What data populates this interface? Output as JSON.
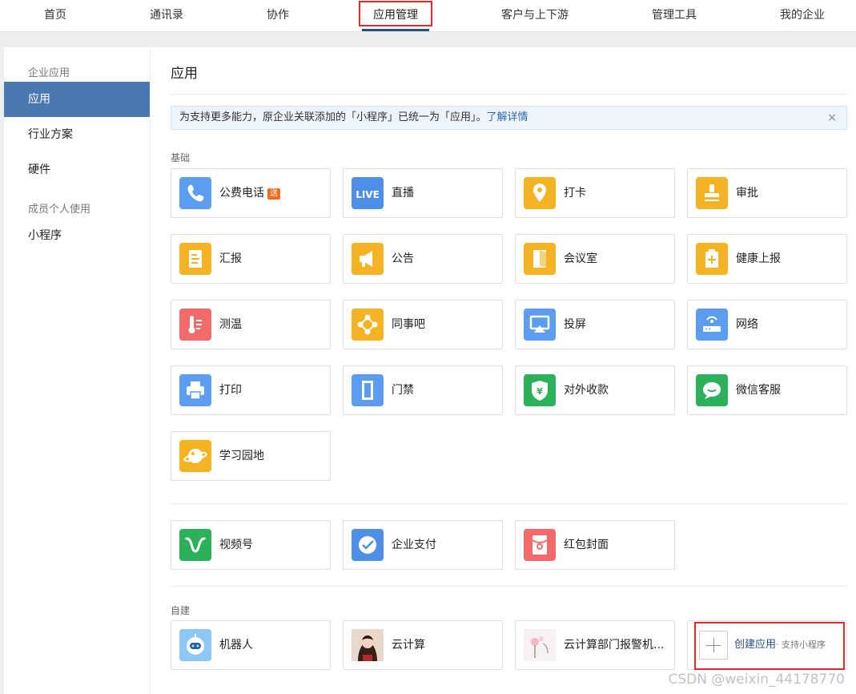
{
  "nav": {
    "tabs": [
      {
        "label": "首页"
      },
      {
        "label": "通讯录"
      },
      {
        "label": "协作"
      },
      {
        "label": "应用管理",
        "active": true
      },
      {
        "label": "客户与上下游"
      },
      {
        "label": "管理工具"
      },
      {
        "label": "我的企业"
      }
    ]
  },
  "sidebar": {
    "group1": "企业应用",
    "items1": [
      "应用",
      "行业方案",
      "硬件"
    ],
    "group2": "成员个人使用",
    "items2": [
      "小程序"
    ]
  },
  "main": {
    "title": "应用",
    "notice": {
      "text": "为支持更多能力，原企业关联添加的「小程序」已统一为「应用」。",
      "link": "了解详情",
      "close": "×"
    },
    "sections": {
      "basic": "基础",
      "custom": "自建"
    },
    "basic_apps": [
      {
        "name": "公费电话",
        "badge": "送",
        "icon": "phone-icon",
        "color": "#5b9ef1"
      },
      {
        "name": "直播",
        "icon": "live-icon",
        "color": "#4d8fe6"
      },
      {
        "name": "打卡",
        "icon": "location-pin-icon",
        "color": "#f5b324"
      },
      {
        "name": "审批",
        "icon": "stamp-icon",
        "color": "#f5b324"
      },
      {
        "name": "汇报",
        "icon": "report-icon",
        "color": "#f5b324"
      },
      {
        "name": "公告",
        "icon": "megaphone-icon",
        "color": "#f5b324"
      },
      {
        "name": "会议室",
        "icon": "door-icon",
        "color": "#f5b324"
      },
      {
        "name": "健康上报",
        "icon": "health-icon",
        "color": "#f5b324"
      },
      {
        "name": "测温",
        "icon": "thermometer-icon",
        "color": "#f26a6a"
      },
      {
        "name": "同事吧",
        "icon": "nodes-icon",
        "color": "#f5b324"
      },
      {
        "name": "投屏",
        "icon": "screencast-icon",
        "color": "#5b9ef1"
      },
      {
        "name": "网络",
        "icon": "router-icon",
        "color": "#5b9ef1"
      },
      {
        "name": "打印",
        "icon": "printer-icon",
        "color": "#5b9ef1"
      },
      {
        "name": "门禁",
        "icon": "door-access-icon",
        "color": "#5b9ef1"
      },
      {
        "name": "对外收款",
        "icon": "yuan-shield-icon",
        "color": "#2bb15a"
      },
      {
        "name": "微信客服",
        "icon": "chat-bubble-icon",
        "color": "#2bb15a"
      },
      {
        "name": "学习园地",
        "icon": "planet-icon",
        "color": "#f5b324"
      }
    ],
    "other_apps": [
      {
        "name": "视频号",
        "icon": "channels-icon",
        "color": "#2bb15a"
      },
      {
        "name": "企业支付",
        "icon": "payment-icon",
        "color": "#4d8fe6"
      },
      {
        "name": "红包封面",
        "icon": "red-packet-icon",
        "color": "#f26a6a"
      }
    ],
    "custom_apps": [
      {
        "name": "机器人",
        "icon": "robot-icon",
        "color": "#8cc7f5"
      },
      {
        "name": "云计算",
        "icon": "avatar-photo-icon",
        "color": "#d9c3b4"
      },
      {
        "name": "云计算部门报警机...",
        "icon": "flower-photo-icon",
        "color": "#f2e6ea"
      }
    ],
    "create": {
      "label": "创建应用",
      "sub": "· 支持小程序"
    }
  },
  "watermark": "CSDN @weixin_44178770"
}
